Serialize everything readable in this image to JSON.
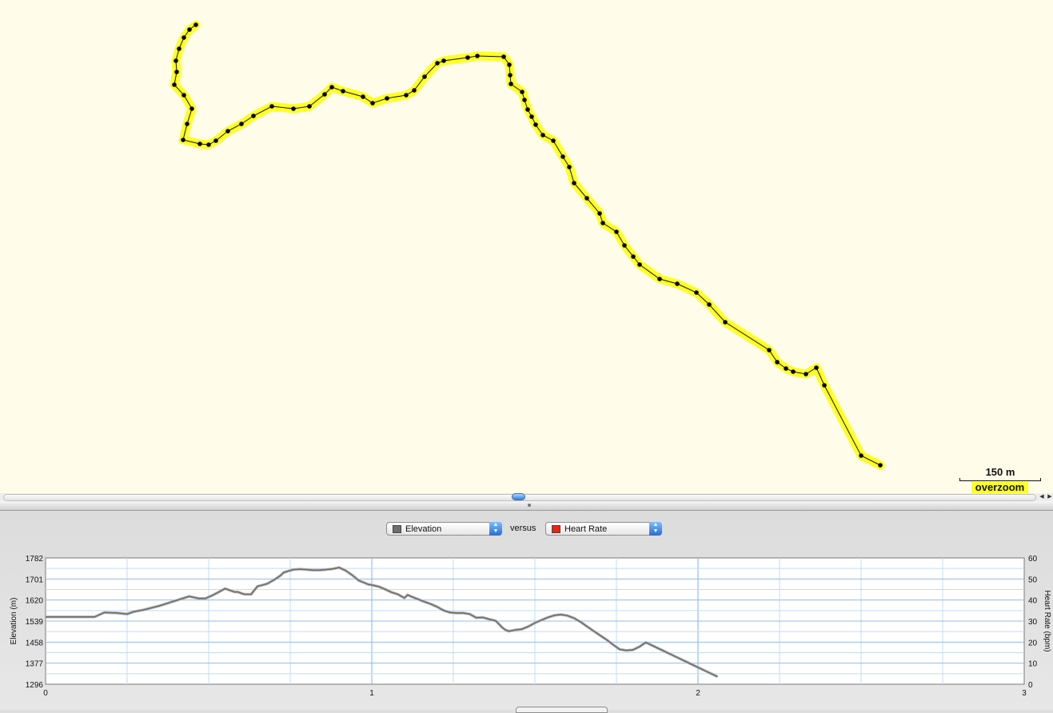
{
  "map": {
    "scale_label": "150 m",
    "overzoom_label": "overzoom",
    "route_color": "#ffff22",
    "track_color": "#111111"
  },
  "controls": {
    "left_metric": {
      "label": "Elevation",
      "color": "#6e6e6e"
    },
    "versus_label": "versus",
    "right_metric": {
      "label": "Heart Rate",
      "color": "#ee2211"
    }
  },
  "chart_data": {
    "type": "line",
    "xlabel": "",
    "ylabel": "Elevation (m)",
    "y2label": "Heart Rate (bpm)",
    "xlim": [
      0,
      3
    ],
    "ylim": [
      1296,
      1782
    ],
    "y2lim": [
      0,
      60
    ],
    "xticks": [
      "0",
      "1",
      "2",
      "3"
    ],
    "yticks": [
      "1782",
      "1701",
      "1620",
      "1539",
      "1458",
      "1377",
      "1296"
    ],
    "y2ticks": [
      "60",
      "50",
      "40",
      "30",
      "20",
      "10",
      "0"
    ],
    "grid": true,
    "series": [
      {
        "name": "Elevation",
        "color": "#6e6e6e",
        "x": [
          0,
          0.15,
          0.18,
          0.22,
          0.25,
          0.27,
          0.3,
          0.35,
          0.4,
          0.44,
          0.47,
          0.49,
          0.51,
          0.53,
          0.55,
          0.58,
          0.59,
          0.6,
          0.61,
          0.63,
          0.65,
          0.66,
          0.68,
          0.7,
          0.72,
          0.73,
          0.74,
          0.76,
          0.78,
          0.8,
          0.82,
          0.84,
          0.86,
          0.88,
          0.9,
          0.92,
          0.94,
          0.96,
          0.98,
          0.99,
          1.0,
          1.02,
          1.04,
          1.06,
          1.08,
          1.1,
          1.11,
          1.12,
          1.14,
          1.16,
          1.18,
          1.2,
          1.22,
          1.24,
          1.26,
          1.28,
          1.3,
          1.32,
          1.34,
          1.36,
          1.38,
          1.4,
          1.41,
          1.42,
          1.44,
          1.46,
          1.48,
          1.5,
          1.52,
          1.54,
          1.56,
          1.58,
          1.6,
          1.62,
          1.64,
          1.66,
          1.68,
          1.7,
          1.72,
          1.74,
          1.76,
          1.78,
          1.8,
          1.82,
          1.84,
          1.86,
          1.88,
          1.9,
          1.92,
          1.94,
          1.96,
          1.98,
          2.0,
          2.02,
          2.04,
          2.06
        ],
        "values": [
          1555,
          1555,
          1572,
          1570,
          1566,
          1575,
          1582,
          1598,
          1618,
          1634,
          1626,
          1626,
          1637,
          1650,
          1664,
          1651,
          1651,
          1646,
          1642,
          1642,
          1673,
          1676,
          1683,
          1697,
          1714,
          1726,
          1730,
          1737,
          1739,
          1737,
          1735,
          1735,
          1737,
          1740,
          1745,
          1733,
          1716,
          1695,
          1685,
          1680,
          1678,
          1672,
          1662,
          1650,
          1642,
          1628,
          1640,
          1634,
          1624,
          1614,
          1605,
          1594,
          1580,
          1572,
          1570,
          1570,
          1566,
          1552,
          1553,
          1546,
          1540,
          1514,
          1505,
          1500,
          1505,
          1508,
          1518,
          1532,
          1543,
          1553,
          1561,
          1564,
          1560,
          1550,
          1536,
          1518,
          1501,
          1484,
          1467,
          1448,
          1430,
          1426,
          1428,
          1440,
          1457,
          1445,
          1433,
          1421,
          1409,
          1397,
          1385,
          1373,
          1361,
          1349,
          1337,
          1325
        ]
      }
    ]
  }
}
